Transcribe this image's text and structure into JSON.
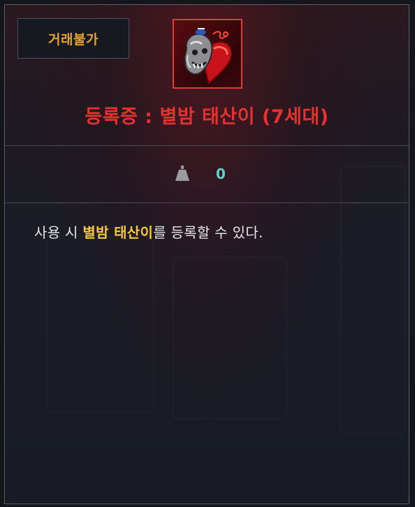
{
  "badge": {
    "label": "거래불가",
    "color": "#e8a030"
  },
  "item": {
    "icon": "heart-skull-icon",
    "title": "등록증 : 별밤 태산이 (7세대)",
    "title_color": "#e5322f",
    "rarity_border_color": "#e13a3a"
  },
  "weight": {
    "icon": "weight-icon",
    "value": "0",
    "value_color": "#5fd0c8"
  },
  "description": {
    "prefix": "사용 시 ",
    "highlight": "별밤 태산이",
    "suffix": "를 등록할 수 있다.",
    "highlight_color": "#f2c640"
  }
}
